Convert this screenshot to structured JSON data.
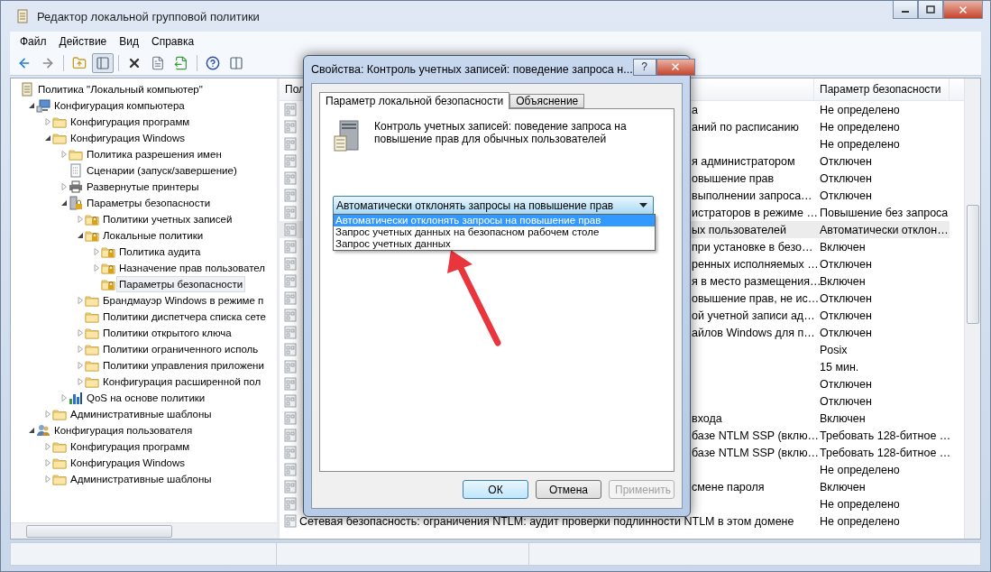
{
  "window": {
    "title": "Редактор локальной групповой политики"
  },
  "menu": [
    "Файл",
    "Действие",
    "Вид",
    "Справка"
  ],
  "toolbar": [
    {
      "kind": "back",
      "disabled": false,
      "pressed": false
    },
    {
      "kind": "forward",
      "disabled": true,
      "pressed": false
    },
    {
      "kind": "up",
      "disabled": false,
      "pressed": false
    },
    {
      "kind": "tree",
      "disabled": false,
      "pressed": true
    },
    {
      "kind": "delete",
      "disabled": false,
      "pressed": false
    },
    {
      "kind": "properties",
      "disabled": false,
      "pressed": false
    },
    {
      "kind": "export",
      "disabled": false,
      "pressed": false
    },
    {
      "kind": "help",
      "disabled": false,
      "pressed": false
    },
    {
      "kind": "view",
      "disabled": false,
      "pressed": false
    }
  ],
  "tree": {
    "items": [
      {
        "label": "Политика \"Локальный компьютер\"",
        "kind": "document",
        "selected": false,
        "children": [
          {
            "label": "Конфигурация компьютера",
            "kind": "computer",
            "expanded": true,
            "selected": false,
            "children": [
              {
                "label": "Конфигурация программ",
                "kind": "folder",
                "expanded": false,
                "selected": false
              },
              {
                "label": "Конфигурация Windows",
                "kind": "folder",
                "expanded": true,
                "selected": false,
                "children": [
                  {
                    "label": "Политика разрешения имен",
                    "kind": "folder",
                    "expanded": false,
                    "selected": false
                  },
                  {
                    "label": "Сценарии (запуск/завершение)",
                    "kind": "script",
                    "selected": false
                  },
                  {
                    "label": "Развернутые принтеры",
                    "kind": "printer",
                    "expanded": false,
                    "selected": false
                  },
                  {
                    "label": "Параметры безопасности",
                    "kind": "security",
                    "expanded": true,
                    "selected": false,
                    "children": [
                      {
                        "label": "Политики учетных записей",
                        "kind": "secure-folder",
                        "expanded": false,
                        "selected": false
                      },
                      {
                        "label": "Локальные политики",
                        "kind": "secure-folder",
                        "expanded": true,
                        "selected": false,
                        "children": [
                          {
                            "label": "Политика аудита",
                            "kind": "secure-folder",
                            "expanded": false,
                            "selected": false
                          },
                          {
                            "label": "Назначение прав пользовател",
                            "kind": "secure-folder",
                            "expanded": false,
                            "selected": false
                          },
                          {
                            "label": "Параметры безопасности",
                            "kind": "secure-folder",
                            "selected": true
                          }
                        ]
                      },
                      {
                        "label": "Брандмауэр Windows в режиме п",
                        "kind": "folder",
                        "expanded": false,
                        "selected": false
                      },
                      {
                        "label": "Политики диспетчера списка сете",
                        "kind": "folder",
                        "selected": false
                      },
                      {
                        "label": "Политики открытого ключа",
                        "kind": "folder",
                        "expanded": false,
                        "selected": false
                      },
                      {
                        "label": "Политики ограниченного исполь",
                        "kind": "folder",
                        "expanded": false,
                        "selected": false
                      },
                      {
                        "label": "Политики управления приложени",
                        "kind": "folder",
                        "expanded": false,
                        "selected": false
                      },
                      {
                        "label": "Конфигурация расширенной пол",
                        "kind": "folder",
                        "expanded": false,
                        "selected": false
                      }
                    ]
                  },
                  {
                    "label": "QoS на основе политики",
                    "kind": "chart",
                    "expanded": false,
                    "selected": false
                  }
                ]
              },
              {
                "label": "Административные шаблоны",
                "kind": "folder",
                "expanded": false,
                "selected": false
              }
            ]
          },
          {
            "label": "Конфигурация пользователя",
            "kind": "user",
            "expanded": true,
            "selected": false,
            "children": [
              {
                "label": "Конфигурация программ",
                "kind": "folder",
                "expanded": false,
                "selected": false
              },
              {
                "label": "Конфигурация Windows",
                "kind": "folder",
                "expanded": false,
                "selected": false
              },
              {
                "label": "Административные шаблоны",
                "kind": "folder",
                "expanded": false,
                "selected": false
              }
            ]
          }
        ]
      }
    ]
  },
  "list": {
    "columns": [
      "Пол",
      "Параметр безопасности"
    ],
    "rows": [
      {
        "tail": "а",
        "value": "Не определено",
        "selected": false
      },
      {
        "tail": "аний по расписанию",
        "value": "Не определено",
        "selected": false
      },
      {
        "value": "Не определено",
        "selected": false
      },
      {
        "tail": "я администратором",
        "value": "Отключен",
        "selected": false
      },
      {
        "tail": "овышение прав",
        "value": "Отключен",
        "selected": false
      },
      {
        "tail": "выполнении запроса…",
        "value": "Отключен",
        "selected": false
      },
      {
        "tail": "истраторов в режиме …",
        "value": "Повышение без запроса",
        "selected": false
      },
      {
        "tail": "ых пользователей",
        "value": "Автоматически отклон…",
        "selected": true
      },
      {
        "tail": "при установке в безо…",
        "value": "Включен",
        "selected": false
      },
      {
        "tail": "ренных исполняемых …",
        "value": "Отключен",
        "selected": false
      },
      {
        "tail": "я в место размещения…",
        "value": "Включен",
        "selected": false
      },
      {
        "tail": "овышение прав, не ис…",
        "value": "Отключен",
        "selected": false
      },
      {
        "tail": "ой учетной записи ад…",
        "value": "Отключен",
        "selected": false
      },
      {
        "tail": "айлов Windows для п…",
        "value": "Отключен",
        "selected": false
      },
      {
        "value": "Posix",
        "selected": false
      },
      {
        "value": "15 мин.",
        "selected": false
      },
      {
        "value": "Отключен",
        "selected": false
      },
      {
        "value": "Отключен",
        "selected": false
      },
      {
        "tail": "входа",
        "value": "Включен",
        "selected": false
      },
      {
        "tail": "базе NTLM SSP (вклю…",
        "value": "Требовать 128-битное …",
        "selected": false
      },
      {
        "tail": "базе NTLM SSP (вклю…",
        "value": "Требовать 128-битное …",
        "selected": false
      },
      {
        "value": "Не определено",
        "selected": false
      },
      {
        "tail": "смене пароля",
        "value": "Включен",
        "selected": false
      },
      {
        "value": "Не определено",
        "selected": false
      },
      {
        "name": "Сетевая безопасность: ограничения NTLM: аудит проверки подлинности NTLM в этом домене",
        "value": "Не определено",
        "selected": false
      }
    ]
  },
  "dialog": {
    "title": "Свойства: Контроль учетных записей: поведение запроса н...",
    "help_button": "?",
    "tabs": [
      {
        "label": "Параметр локальной безопасности",
        "selected": true
      },
      {
        "label": "Объяснение",
        "selected": false
      }
    ],
    "description": "Контроль учетных записей: поведение запроса на повышение прав для обычных пользователей",
    "dropdown": {
      "value": "Автоматически отклонять запросы на повышение прав",
      "open": true,
      "options": [
        {
          "label": "Автоматически отклонять запросы на повышение прав",
          "selected": true
        },
        {
          "label": "Запрос учетных данных на безопасном рабочем столе",
          "selected": false
        },
        {
          "label": "Запрос учетных данных",
          "selected": false
        }
      ]
    },
    "buttons": [
      {
        "label": "ОК",
        "kind": "default",
        "disabled": false
      },
      {
        "label": "Отмена",
        "kind": "normal",
        "disabled": false
      },
      {
        "label": "Применить",
        "kind": "normal",
        "disabled": true
      }
    ]
  }
}
